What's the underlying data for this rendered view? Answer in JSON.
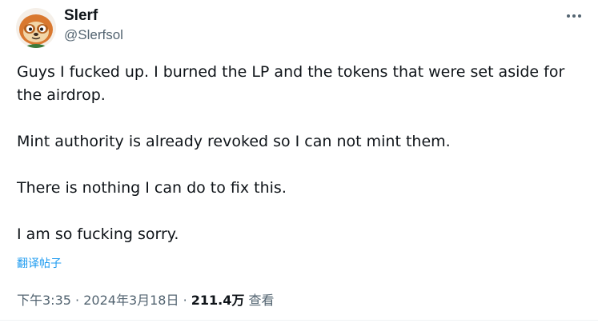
{
  "author": {
    "display_name": "Slerf",
    "handle": "@Slerfsol"
  },
  "post": {
    "paragraphs": [
      "Guys I fucked up. I burned the LP and the tokens that were set aside for the airdrop.",
      "Mint authority is already revoked so I can not mint them.",
      "There is nothing I can do to fix this.",
      "I am so fucking sorry."
    ],
    "translate_label": "翻译帖子"
  },
  "meta": {
    "time": "下午3:35",
    "separator": "·",
    "date": "2024年3月18日",
    "views_count": "211.4万",
    "views_label": "查看"
  },
  "icons": {
    "more": "more-horizontal-icon",
    "avatar": "sloth-avatar"
  },
  "colors": {
    "text_primary": "#0f1419",
    "text_secondary": "#536471",
    "link": "#1d9bf0"
  }
}
